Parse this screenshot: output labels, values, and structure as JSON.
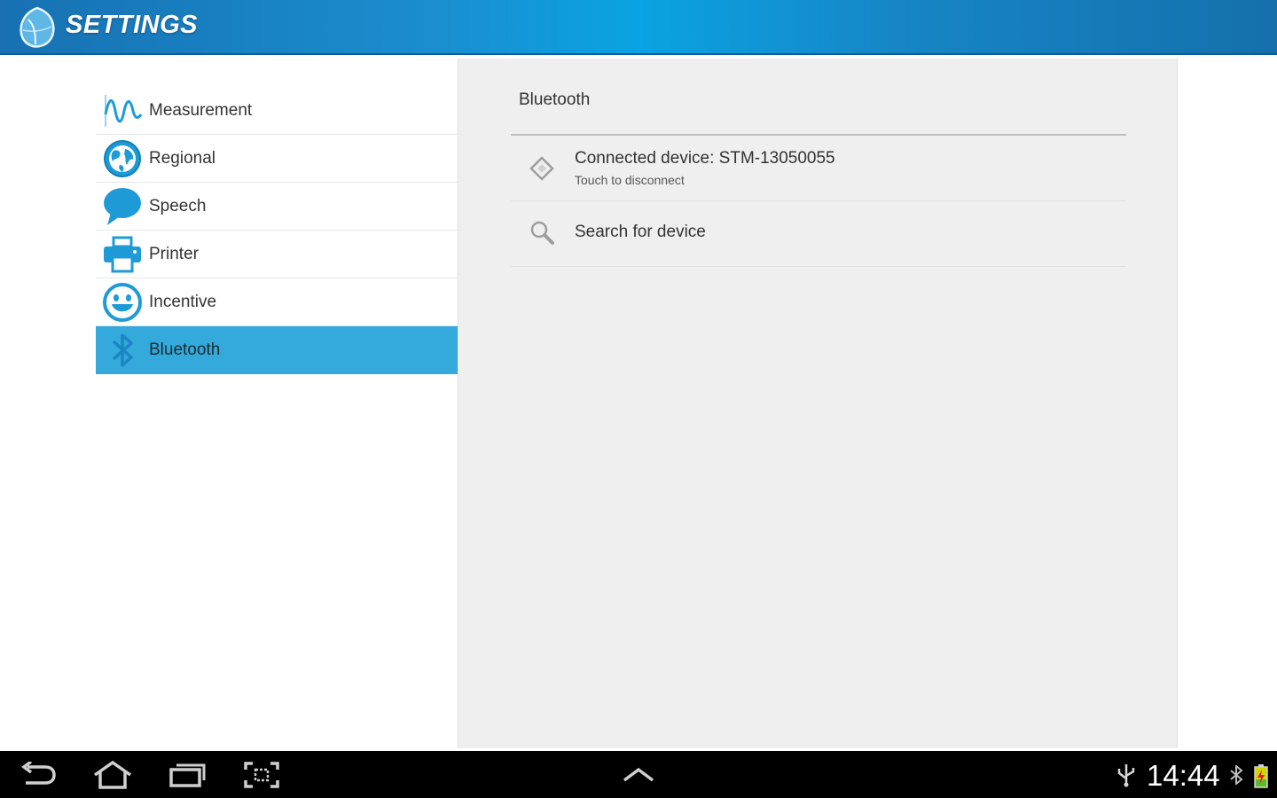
{
  "header": {
    "title": "SETTINGS",
    "logo_icon": "leaf-drop-logo-icon"
  },
  "colors": {
    "accent": "#33aadb",
    "header_blue": "#1a8fd0",
    "icon_blue": "#1e9bd7",
    "panel_bg": "#efefef",
    "nav_bg": "#000000"
  },
  "sidebar": {
    "items": [
      {
        "label": "Measurement",
        "icon": "waveform-icon"
      },
      {
        "label": "Regional",
        "icon": "globe-icon"
      },
      {
        "label": "Speech",
        "icon": "speech-bubble-icon"
      },
      {
        "label": "Printer",
        "icon": "printer-icon"
      },
      {
        "label": "Incentive",
        "icon": "smiley-icon"
      },
      {
        "label": "Bluetooth",
        "icon": "bluetooth-icon",
        "selected": true
      }
    ]
  },
  "panel": {
    "title": "Bluetooth",
    "rows": [
      {
        "title": "Connected device: STM-13050055",
        "summary": "Touch to disconnect",
        "icon": "device-diamond-icon"
      },
      {
        "title": "Search for device",
        "icon": "search-icon"
      }
    ]
  },
  "navbar": {
    "buttons": [
      "back-icon",
      "home-icon",
      "recent-apps-icon",
      "screenshot-icon",
      "chevron-up-icon"
    ],
    "clock": "14:44",
    "status_icons": [
      "usb-icon",
      "bluetooth-status-icon",
      "battery-icon"
    ]
  }
}
